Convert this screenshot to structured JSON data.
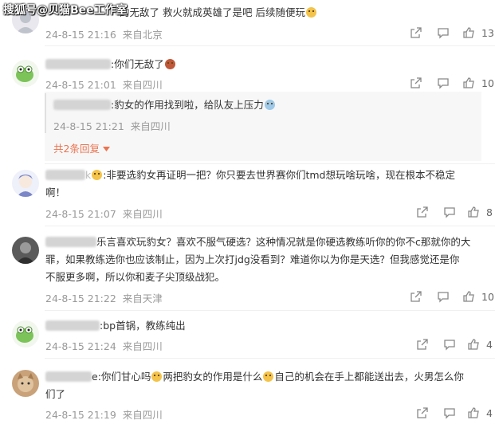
{
  "watermark": "搜狐号@贝猫Bee工作室",
  "comments": [
    {
      "text_before": "的无敌了  救火就成英雄了是吧  后续随便玩",
      "time": "24-8-15 21:16",
      "location": "来自北京",
      "likes": "13"
    },
    {
      "text_before": ":你们无敌了",
      "time": "24-8-15 21:01",
      "location": "来自四川",
      "likes": "10",
      "reply": {
        "text": ":豹女的作用找到啦，给队友上压力",
        "time": "24-8-15 21:21",
        "location": "来自四川"
      },
      "more_replies": "共2条回复"
    },
    {
      "line1": ":非要选豹女再证明一把？你只要去世界赛你们tmd想玩啥玩啥，现在根本不稳定",
      "line2": "啊！",
      "time": "24-8-15 21:07",
      "location": "来自四川",
      "likes": "8"
    },
    {
      "line1": "乐言喜欢玩豹女？喜欢不服气硬选？这种情况就是你硬选教练听你的你不c那就你的大",
      "line2": "罪，如果教练选你也应该制止，因为上次打jdg没看到？难道你以为你是天选？但我感觉还是你",
      "line3": "不服更多啊，所以你和麦子尖顶级战犯。",
      "time": "24-8-15 21:22",
      "location": "来自天津",
      "likes": "10"
    },
    {
      "text_before": ":bp首锅，教练纯出",
      "time": "24-8-15 21:24",
      "location": "来自四川",
      "likes": "4"
    },
    {
      "seg1": "e:你们甘心吗",
      "seg2": "两把豹女的作用是什么",
      "seg3": "自己的机会在手上都能送出去，火男怎么你",
      "line2": "们了",
      "time": "24-8-15 21:19",
      "location": "来自四川",
      "likes": "4"
    }
  ],
  "icons": [
    "share-icon",
    "comment-icon",
    "like-icon",
    "chevron-down-icon"
  ]
}
